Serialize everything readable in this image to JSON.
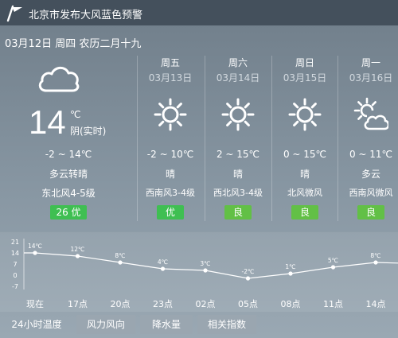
{
  "alert": {
    "text": "北京市发布大风蓝色预警"
  },
  "date_line": "03月12日 周四 农历二月十九",
  "today": {
    "temp": "14",
    "unit": "℃",
    "realtime": "阴(实时)",
    "range": "-2 ~ 14℃",
    "condition": "多云转晴",
    "wind": "东北风4-5级",
    "aqi": "26 优",
    "aqi_color": "#3fbf52",
    "icon": "cloud-icon"
  },
  "forecast": [
    {
      "weekday": "周五",
      "date": "03月13日",
      "icon": "sun-icon",
      "range": "-2 ~ 10℃",
      "condition": "晴",
      "wind": "西南风3-4级",
      "aqi": "优",
      "aqi_color": "#3fbf52"
    },
    {
      "weekday": "周六",
      "date": "03月14日",
      "icon": "sun-icon",
      "range": "2 ~ 15℃",
      "condition": "晴",
      "wind": "西北风3-4级",
      "aqi": "良",
      "aqi_color": "#62c046"
    },
    {
      "weekday": "周日",
      "date": "03月15日",
      "icon": "sun-icon",
      "range": "0 ~ 15℃",
      "condition": "晴",
      "wind": "北风微风",
      "aqi": "良",
      "aqi_color": "#62c046"
    },
    {
      "weekday": "周一",
      "date": "03月16日",
      "icon": "partly-cloudy-icon",
      "range": "0 ~ 11℃",
      "condition": "多云",
      "wind": "西南风微风",
      "aqi": "良",
      "aqi_color": "#62c046"
    }
  ],
  "chart_data": {
    "type": "line",
    "x": [
      "现在",
      "17点",
      "20点",
      "23点",
      "02点",
      "05点",
      "08点",
      "11点",
      "14点"
    ],
    "values": [
      14,
      12,
      8,
      4,
      3,
      -2,
      1,
      5,
      8
    ],
    "point_labels": [
      "14℃",
      "12℃",
      "8℃",
      "4℃",
      "3℃",
      "-2℃",
      "1℃",
      "5℃",
      "8℃"
    ],
    "y_ticks": [
      "21",
      "14",
      "7",
      "0",
      "-7"
    ],
    "y_tick_values": [
      21,
      14,
      7,
      0,
      -7
    ],
    "ylim": [
      -7,
      21
    ],
    "grid": false
  },
  "tabs": [
    {
      "label": "24小时温度",
      "active": true
    },
    {
      "label": "风力风向",
      "active": false
    },
    {
      "label": "降水量",
      "active": false
    },
    {
      "label": "相关指数",
      "active": false
    }
  ]
}
